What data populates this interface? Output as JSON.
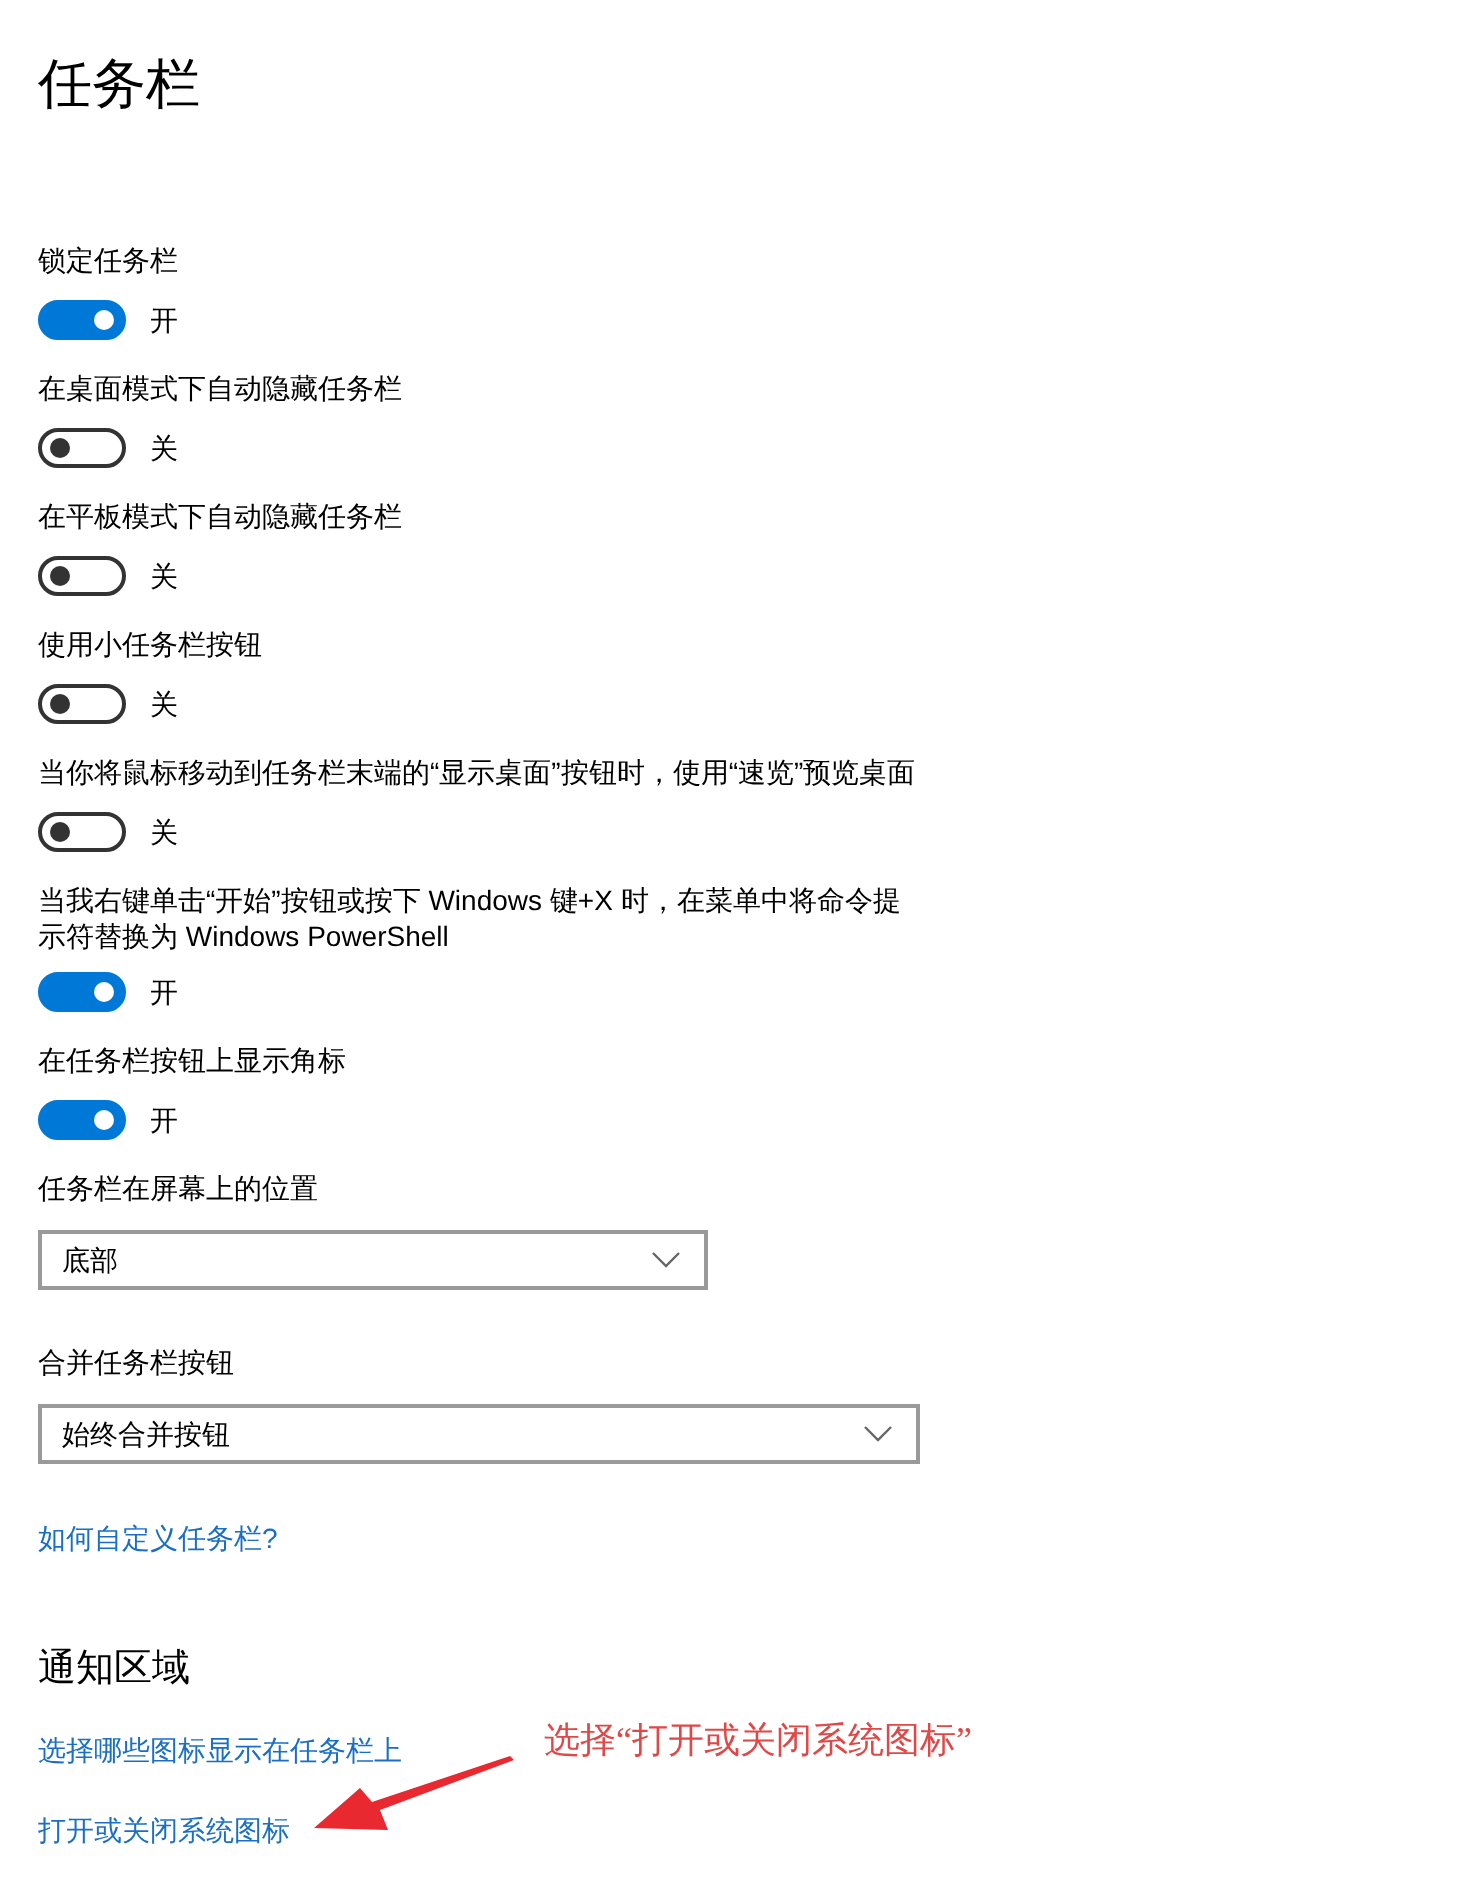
{
  "page": {
    "title": "任务栏"
  },
  "settings": [
    {
      "kind": "toggle",
      "label": "锁定任务栏",
      "on": true,
      "state_text": "开"
    },
    {
      "kind": "toggle",
      "label": "在桌面模式下自动隐藏任务栏",
      "on": false,
      "state_text": "关"
    },
    {
      "kind": "toggle",
      "label": "在平板模式下自动隐藏任务栏",
      "on": false,
      "state_text": "关"
    },
    {
      "kind": "toggle",
      "label": "使用小任务栏按钮",
      "on": false,
      "state_text": "关"
    },
    {
      "kind": "toggle",
      "label": "当你将鼠标移动到任务栏末端的“显示桌面”按钮时，使用“速览”预览桌面",
      "on": false,
      "state_text": "关"
    },
    {
      "kind": "toggle",
      "label": "当我右键单击“开始”按钮或按下 Windows 键+X 时，在菜单中将命令提示符替换为 Windows PowerShell",
      "on": true,
      "state_text": "开"
    },
    {
      "kind": "toggle",
      "label": "在任务栏按钮上显示角标",
      "on": true,
      "state_text": "开"
    },
    {
      "kind": "dropdown",
      "label": "任务栏在屏幕上的位置",
      "value": "底部"
    },
    {
      "kind": "dropdown",
      "label": "合并任务栏按钮",
      "value": "始终合并按钮"
    }
  ],
  "help_link": "如何自定义任务栏?",
  "notification_area": {
    "heading": "通知区域",
    "links": [
      "选择哪些图标显示在任务栏上",
      "打开或关闭系统图标"
    ]
  },
  "annotation": {
    "text": "选择“打开或关闭系统图标”"
  }
}
